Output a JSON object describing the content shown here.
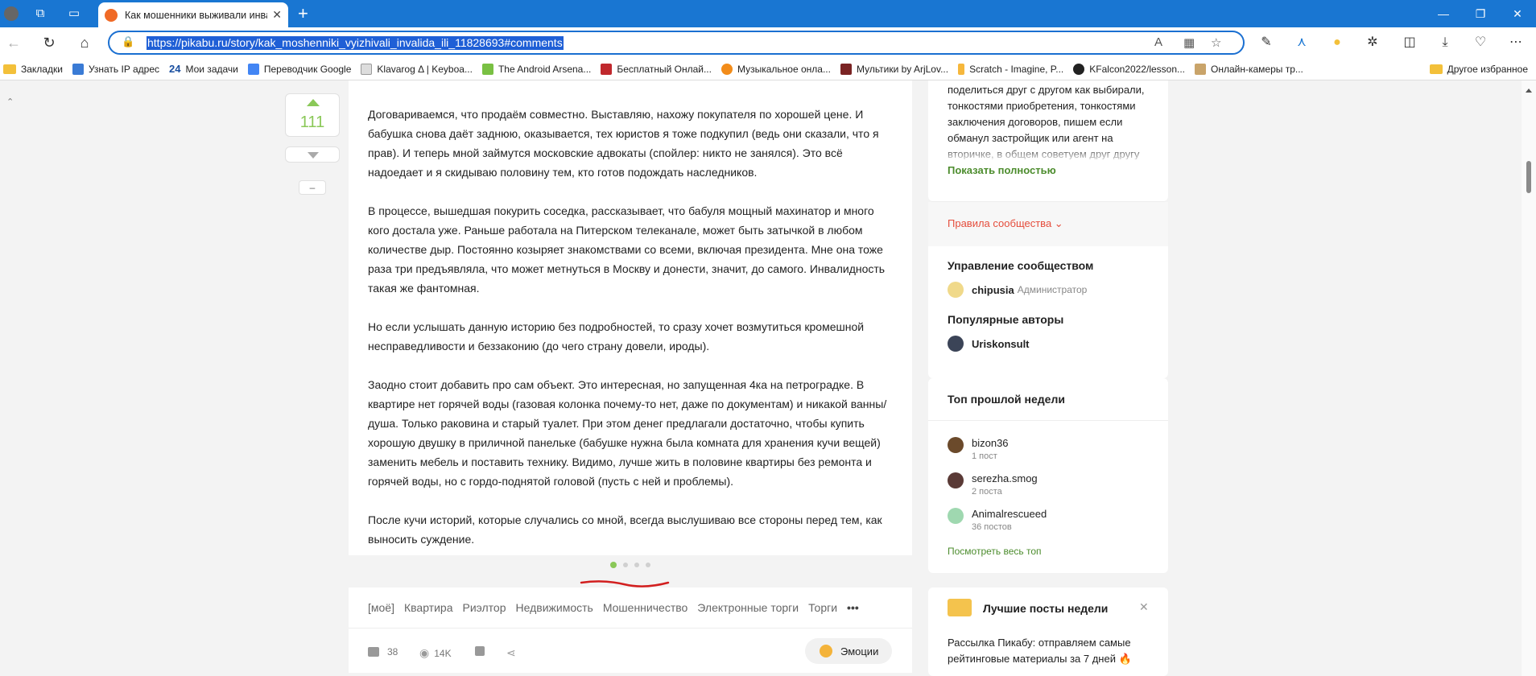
{
  "browser": {
    "tab_title": "Как мошенники выживали инва",
    "url": "https://pikabu.ru/story/kak_moshenniki_vyizhivali_invalida_ili_11828693#comments",
    "bookmarks": [
      "Закладки",
      "Узнать IP адрес",
      "Мои задачи",
      "Переводчик Google",
      "Klavarog Δ | Keyboa...",
      "The Android Arsena...",
      "Бесплатный Онлай...",
      "Музыкальное онла...",
      "Мультики by ArjLov...",
      "Scratch - Imagine, P...",
      "KFalcon2022/lesson...",
      "Онлайн-камеры тр..."
    ],
    "other_bookmarks": "Другое избранное"
  },
  "post": {
    "rating": "111",
    "paragraphs": [
      "Договариваемся, что продаём совместно. Выставляю, нахожу покупателя по хорошей цене. И бабушка снова даёт заднюю, оказывается, тех юристов я тоже подкупил (ведь они сказали, что я прав). И теперь мной займутся московские адвокаты (спойлер: никто не занялся). Это всё надоедает и я скидываю половину тем, кто готов подождать наследников.",
      "В процессе, вышедшая покурить соседка, рассказывает, что бабуля мощный махинатор и много кого достала уже. Раньше работала на Питерском телеканале, может быть затычкой в любом количестве дыр. Постоянно козыряет знакомствами со всеми, включая президента. Мне она тоже раза три предъявляла, что может метнуться в Москву и донести, значит, до самого. Инвалидность такая же фантомная.",
      "Но если услышать данную историю без подробностей, то сразу хочет возмутиться кромешной несправедливости и беззаконию (до чего страну довели, ироды).",
      "Заодно стоит добавить про сам объект. Это интересная, но запущенная 4ка на петроградке. В квартире нет горячей воды (газовая колонка почему-то нет, даже по документам) и никакой ванны/душа. Только раковина и старый туалет. При этом денег предлагали достаточно, чтобы купить хорошую двушку в приличной панельке (бабушке нужна была комната для хранения кучи вещей) заменить мебель и поставить технику. Видимо, лучше жить в половине квартиры без ремонта и горячей воды, но с гордо-поднятой головой (пусть с ней и проблемы).",
      "После кучи историй, которые случались со мной, всегда выслушиваю все стороны перед тем, как выносить суждение."
    ],
    "tags": [
      "[моё]",
      "Квартира",
      "Риэлтор",
      "Недвижимость",
      "Мошенничество",
      "Электронные торги",
      "Торги",
      "•••"
    ],
    "comments_count": "38",
    "views": "14K",
    "emotions_label": "Эмоции",
    "minus": "–"
  },
  "sidebar": {
    "community_desc": "поделиться друг с другом как выбирали, тонкостями приобретения, тонкостями заключения договоров, пишем если обманул застройщик или агент на вторичке, в общем советуем друг другу",
    "show_full": "Показать полностью",
    "rules": "Правила сообщества ⌄",
    "management_title": "Управление сообществом",
    "admin_name": "chipusia",
    "admin_role": "Администратор",
    "popular_title": "Популярные авторы",
    "popular_author": "Uriskonsult",
    "top_title": "Топ прошлой недели",
    "top": [
      {
        "name": "bizon36",
        "sub": "1 пост"
      },
      {
        "name": "serezha.smog",
        "sub": "2 поста"
      },
      {
        "name": "Animalrescueed",
        "sub": "36 постов"
      }
    ],
    "see_top": "Посмотреть весь топ",
    "best_title": "Лучшие посты недели",
    "best_text": "Рассылка Пикабу: отправляем самые рейтинговые материалы за 7 дней 🔥"
  },
  "colors": {
    "accent": "#8ac858",
    "link_green": "#4c8c2d",
    "rules_red": "#e54d3c",
    "title_bar": "#1976d2"
  },
  "slider": {
    "pages": 4,
    "active": 1
  }
}
